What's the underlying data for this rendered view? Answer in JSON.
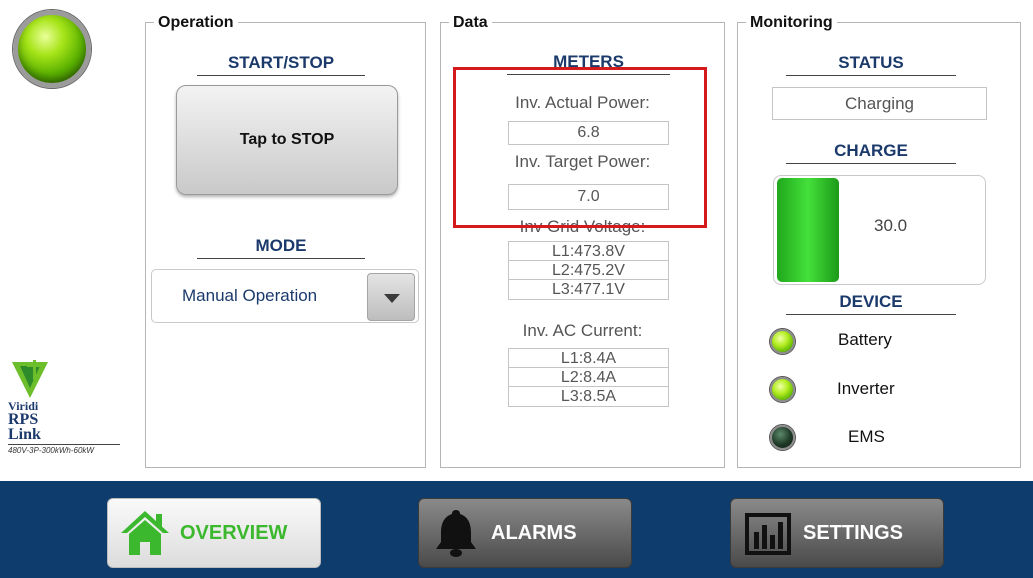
{
  "operation": {
    "title": "Operation",
    "start_stop_heading": "START/STOP",
    "start_stop_button": "Tap to STOP",
    "mode_heading": "MODE",
    "mode_value": "Manual Operation"
  },
  "data_panel": {
    "title": "Data",
    "meters_heading": "METERS",
    "actual_power_label": "Inv. Actual Power:",
    "actual_power_value": "6.8",
    "target_power_label": "Inv. Target Power:",
    "target_power_value": "7.0",
    "grid_voltage_label": "Inv Grid Voltage:",
    "grid_voltage": [
      "L1:473.8V",
      "L2:475.2V",
      "L3:477.1V"
    ],
    "ac_current_label": "Inv. AC Current:",
    "ac_current": [
      "L1:8.4A",
      "L2:8.4A",
      "L3:8.5A"
    ]
  },
  "monitoring": {
    "title": "Monitoring",
    "status_heading": "STATUS",
    "status_value": "Charging",
    "charge_heading": "CHARGE",
    "charge_value": "30.0",
    "device_heading": "DEVICE",
    "devices": [
      {
        "name": "Battery",
        "state": "on"
      },
      {
        "name": "Inverter",
        "state": "on"
      },
      {
        "name": "EMS",
        "state": "off"
      }
    ]
  },
  "logo": {
    "brand": "Viridi",
    "product_line1": "RPS",
    "product_line2": "Link",
    "spec": "480V-3P-300kWh-60kW"
  },
  "nav": {
    "overview": "OVERVIEW",
    "alarms": "ALARMS",
    "settings": "SETTINGS"
  },
  "colors": {
    "nav_bar": "#0e3d6d",
    "heading": "#1b3a6b",
    "active_nav_text": "#3cb82e",
    "highlight": "#d41a1a"
  },
  "icons": [
    "status-led-icon",
    "viridi-logo-icon",
    "dropdown-arrow-icon",
    "home-icon",
    "bell-icon",
    "bar-chart-icon"
  ]
}
